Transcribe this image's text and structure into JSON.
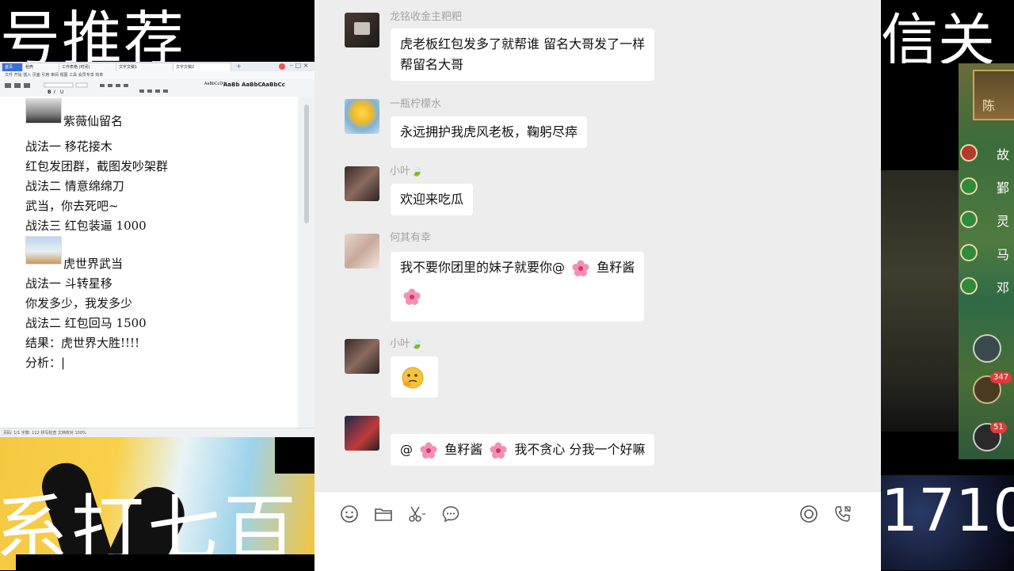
{
  "overlay": {
    "left_top_text": "号推荐",
    "left_bottom_text": "系打七百",
    "right_top_text": "信关",
    "right_bottom_text": "1710"
  },
  "doc": {
    "tabs": [
      "首页",
      "稻壳",
      "工作表格 (时间)",
      "文字文稿1",
      "文字文稿2"
    ],
    "menu": "文件 开始 插入 页面 引用 审阅 视图 工具 会员专享 效率",
    "styles": [
      "AaBbCcDd",
      "AaBb",
      "AaBbC",
      "AaBbCc"
    ],
    "status": "页码: 1/1  字数: 112  拼写检查  文档校对  100%",
    "lines": [
      {
        "text": "紫薇仙留名",
        "indent": true
      },
      {
        "text": "战法一  移花接木"
      },
      {
        "text": "红包发团群，截图发吵架群"
      },
      {
        "text": "战法二  情意绵绵刀"
      },
      {
        "text": "武当，你去死吧~"
      },
      {
        "text": "战法三  红包装逼  1000"
      },
      {
        "text": "虎世界武当",
        "indent": true
      },
      {
        "text": "战法一  斗转星移"
      },
      {
        "text": "你发多少，我发多少"
      },
      {
        "text": "战法二  红包回马    1500"
      },
      {
        "text": "结果：虎世界大胜!!!!"
      },
      {
        "text": "分析：|"
      }
    ]
  },
  "chat": {
    "messages": [
      {
        "sender": "龙铭收金主粑粑",
        "lines": [
          "虎老板红包发多了就帮谁 留名大哥发了一样",
          "帮留名大哥"
        ]
      },
      {
        "sender": "一瓶柠檬水",
        "lines": [
          "永远拥护我虎风老板，鞠躬尽瘁"
        ]
      },
      {
        "sender": "小叶🍃",
        "lines": [
          "欢迎来吃瓜"
        ]
      },
      {
        "sender": "何其有幸",
        "lines": [
          "我不要你团里的妹子就要你@",
          "鱼籽酱"
        ]
      },
      {
        "sender": "小叶🍃",
        "lines": [
          "🤔"
        ]
      },
      {
        "sender": "",
        "lines": [
          "@",
          "鱼籽酱",
          "我不贪心 分我一个好嘛"
        ]
      }
    ]
  },
  "toolbar": {
    "icons": [
      "emoji-icon",
      "folder-icon",
      "scissors-icon",
      "chat-bubble-icon",
      "live-icon",
      "phone-icon"
    ]
  },
  "game": {
    "labels": [
      "陈",
      "故",
      "鄞",
      "灵",
      "马",
      "邓"
    ],
    "badges": [
      "347",
      "51"
    ]
  },
  "colors": {
    "chat_bg": "#ededed",
    "bubble": "#ffffff",
    "sender": "#a3a3a3",
    "banner_yellow": "#f5c842"
  }
}
